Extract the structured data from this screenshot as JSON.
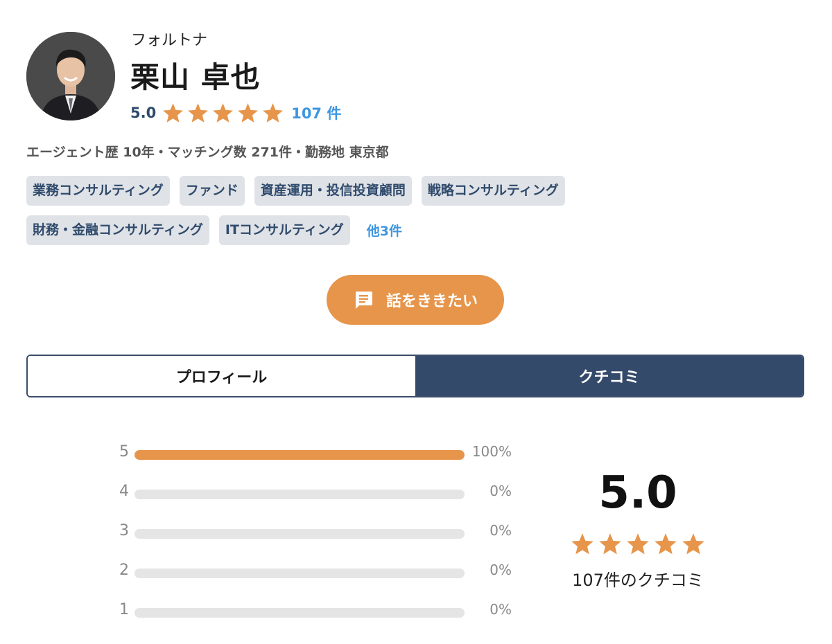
{
  "profile": {
    "company": "フォルトナ",
    "name": "栗山 卓也",
    "rating": "5.0",
    "star_count": 5,
    "review_count_label": "107 件",
    "meta": "エージェント歴 10年・マッチング数 271件・勤務地 東京都"
  },
  "tags": {
    "row1": [
      "業務コンサルティング",
      "ファンド",
      "資産運用・投信投資顧問",
      "戦略コンサルティング"
    ],
    "row2": [
      "財務・金融コンサルティング",
      "ITコンサルティング"
    ],
    "more_label": "他3件"
  },
  "cta": {
    "label": "話をききたい",
    "icon": "chat-bubble-icon"
  },
  "tabs": [
    {
      "label": "プロフィール",
      "active": false
    },
    {
      "label": "クチコミ",
      "active": true
    }
  ],
  "distribution": [
    {
      "star": "5",
      "fraction": 1.0,
      "pct_label": "100%"
    },
    {
      "star": "4",
      "fraction": 0.0,
      "pct_label": "0%"
    },
    {
      "star": "3",
      "fraction": 0.0,
      "pct_label": "0%"
    },
    {
      "star": "2",
      "fraction": 0.0,
      "pct_label": "0%"
    },
    {
      "star": "1",
      "fraction": 0.0,
      "pct_label": "0%"
    }
  ],
  "summary": {
    "score": "5.0",
    "star_count": 5,
    "count_label": "107件のクチコミ"
  },
  "colors": {
    "accent": "#e6954a",
    "navy": "#344a6a",
    "link": "#3d96e0",
    "tag_bg": "#dfe2e6"
  }
}
